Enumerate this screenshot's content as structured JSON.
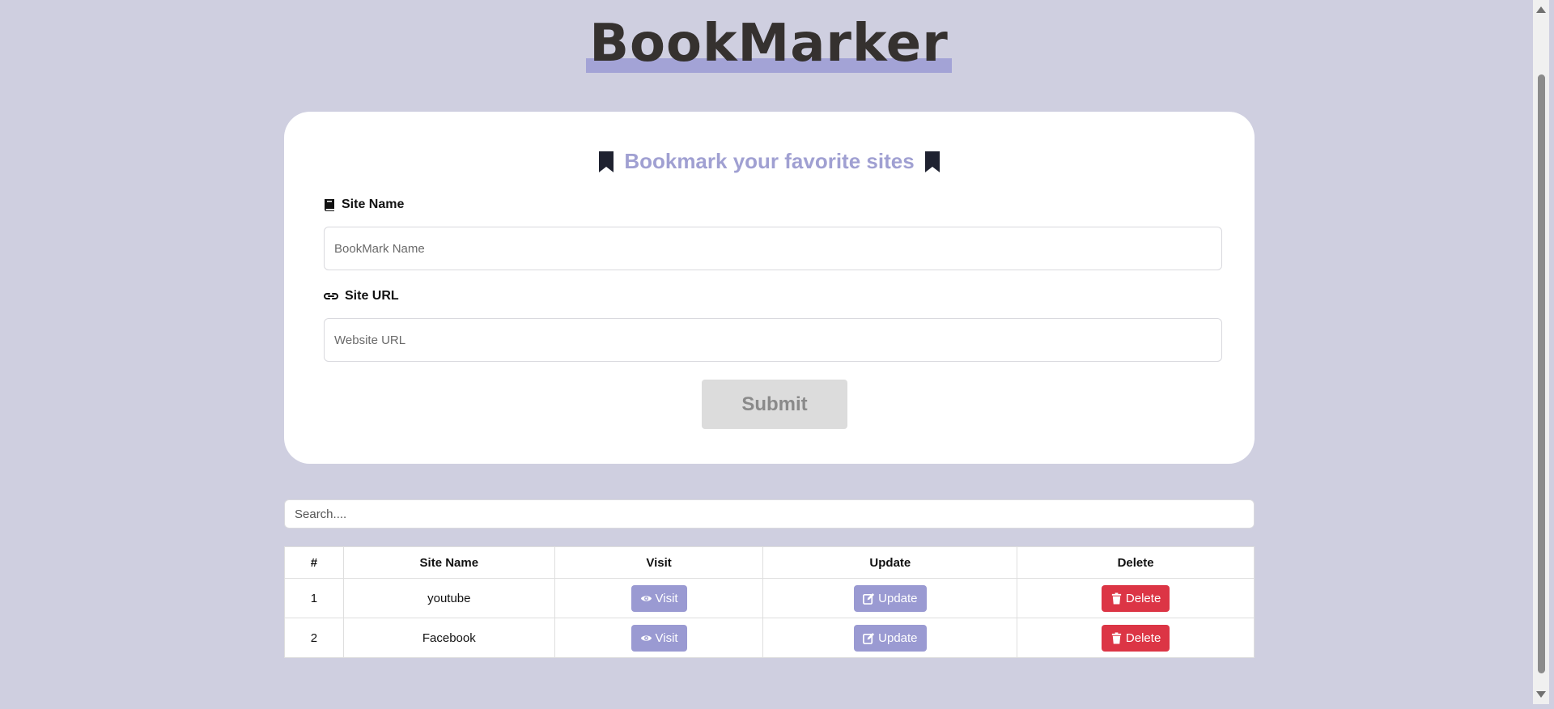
{
  "logo": {
    "text": "BookMarker"
  },
  "form": {
    "title": "Bookmark your favorite sites",
    "site_name_label": "Site Name",
    "site_name_placeholder": "BookMark Name",
    "site_url_label": "Site URL",
    "site_url_placeholder": "Website URL",
    "submit_label": "Submit"
  },
  "search": {
    "placeholder": "Search...."
  },
  "table": {
    "headers": [
      "#",
      "Site Name",
      "Visit",
      "Update",
      "Delete"
    ],
    "rows": [
      {
        "index": "1",
        "name": "youtube"
      },
      {
        "index": "2",
        "name": "Facebook"
      }
    ],
    "visit_label": "Visit",
    "update_label": "Update",
    "delete_label": "Delete"
  },
  "colors": {
    "background": "#cfcfe0",
    "accent": "#a0a0d2",
    "danger": "#dc3545"
  },
  "icons": [
    "bookmark-icon",
    "book-icon",
    "link-icon",
    "eye-icon",
    "edit-icon",
    "trash-icon"
  ]
}
